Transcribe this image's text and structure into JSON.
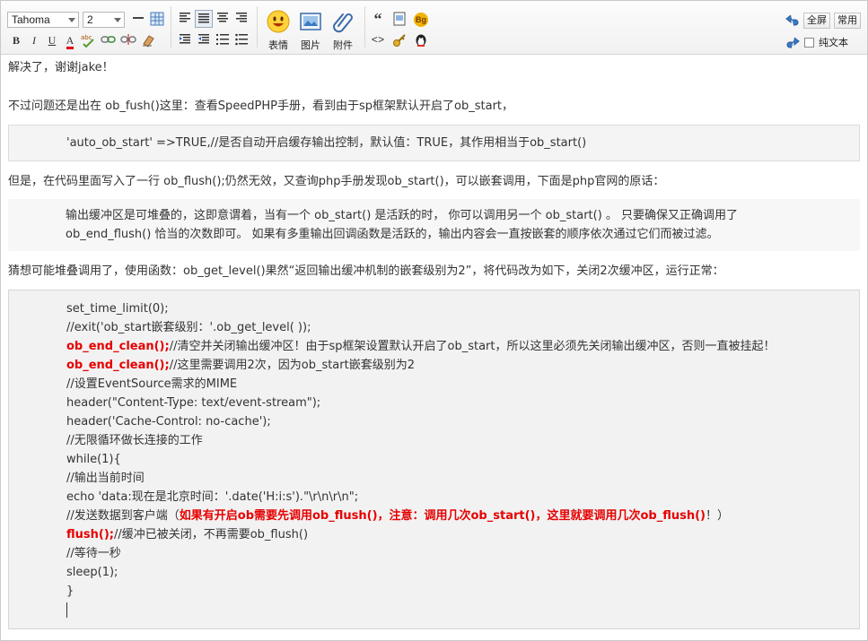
{
  "toolbar": {
    "font_family": "Tahoma",
    "font_size": "2",
    "emoji_label": "表情",
    "image_label": "图片",
    "attach_label": "附件",
    "bold_glyph": "B",
    "italic_glyph": "I",
    "underline_glyph": "U",
    "fontcolor_glyph": "A",
    "bg_glyph": "Bg",
    "quote_glyph": "“",
    "fullscreen_label": "全屏",
    "common_label": "常用",
    "plaintext_label": "纯文本"
  },
  "content": {
    "p1": "解决了，谢谢jake！",
    "p2": "不过问题还是出在 ob_fush()这里：查看SpeedPHP手册，看到由于sp框架默认开启了ob_start，",
    "quote1": "'auto_ob_start' =>TRUE,//是否自动开启缓存输出控制，默认值：TRUE，其作用相当于ob_start()",
    "p3": "但是，在代码里面写入了一行 ob_flush();仍然无效，又查询php手册发现ob_start()，可以嵌套调用，下面是php官网的原话：",
    "quote2_line1": "输出缓冲区是可堆叠的，这即意谓着，当有一个 ob_start() 是活跃的时， 你可以调用另一个 ob_start() 。 只要确保又正确调用了",
    "quote2_line2": "ob_end_flush() 恰当的次数即可。 如果有多重输出回调函数是活跃的，输出内容会一直按嵌套的顺序依次通过它们而被过滤。",
    "p4": "猜想可能堆叠调用了，使用函数：ob_get_level()果然“返回输出缓冲机制的嵌套级别为2”，将代码改为如下，关闭2次缓冲区，运行正常：",
    "code": {
      "l1": "set_time_limit(0);",
      "l2": "//exit('ob_start嵌套级别：'.ob_get_level( ));",
      "l3_red": "ob_end_clean();",
      "l3_rest": "//清空并关闭输出缓冲区！由于sp框架设置默认开启了ob_start，所以这里必须先关闭输出缓冲区，否则一直被挂起！",
      "l4_red": "ob_end_clean();",
      "l4_rest": "//这里需要调用2次，因为ob_start嵌套级别为2",
      "l5": "//设置EventSource需求的MIME",
      "l6": "header(\"Content-Type: text/event-stream\");",
      "l7": "header('Cache-Control: no-cache');",
      "l8": "//无限循环做长连接的工作",
      "l9": "while(1){",
      "l10": "//输出当前时间",
      "l11": "echo 'data:现在是北京时间：'.date('H:i:s').\"\\r\\n\\r\\n\";",
      "l12_pre": "//发送数据到客户端（",
      "l12_red": "如果有开启ob需要先调用ob_flush()，注意：调用几次ob_start()，这里就要调用几次ob_flush()",
      "l12_post": "！）",
      "l13_red": "flush();",
      "l13_rest": "//缓冲已被关闭，不再需要ob_flush()",
      "l14": "//等待一秒",
      "l15": "sleep(1);",
      "l16": "}"
    }
  }
}
